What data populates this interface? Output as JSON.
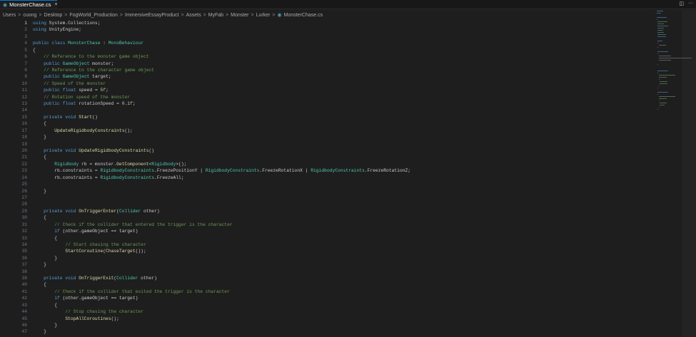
{
  "tab": {
    "icon": "csharp-file-icon",
    "label": "MonsterChase.cs",
    "close": "×"
  },
  "window_actions": [
    {
      "name": "split-editor-icon",
      "glyph": "◫"
    },
    {
      "name": "more-actions-icon",
      "glyph": "···"
    }
  ],
  "breadcrumb": {
    "segments": [
      "Users",
      "cuong",
      "Desktop",
      "FogWorld_Production",
      "ImmersiveEssayProduct",
      "Assets",
      "MyFab",
      "Monster",
      "Lurker"
    ],
    "file": "MonsterChase.cs",
    "separator": ">"
  },
  "colors": {
    "background": "#1e1e1e",
    "keyword": "#569cd6",
    "comment": "#6a9955",
    "number": "#b5cea8",
    "type": "#4ec9b0",
    "function": "#dcdcaa",
    "text": "#cccccc",
    "line_number": "#6e7681",
    "accent": "#0078d4"
  },
  "editor": {
    "active_line": 1,
    "lines": [
      {
        "n": "1",
        "text": "using System.Collections;"
      },
      {
        "n": "2",
        "text": "using UnityEngine;"
      },
      {
        "n": "3",
        "text": ""
      },
      {
        "n": "4",
        "text": "public class MonsterChase : MonoBehaviour"
      },
      {
        "n": "5",
        "text": "{"
      },
      {
        "n": "6",
        "text": "    // Reference to the monster game object"
      },
      {
        "n": "7",
        "text": "    public GameObject monster;"
      },
      {
        "n": "8",
        "text": "    // Reference to the character game object"
      },
      {
        "n": "9",
        "text": "    public GameObject target;"
      },
      {
        "n": "10",
        "text": "    // Speed of the monster"
      },
      {
        "n": "11",
        "text": "    public float speed = 5f;"
      },
      {
        "n": "12",
        "text": "    // Rotation speed of the monster"
      },
      {
        "n": "13",
        "text": "    public float rotationSpeed = 0.1f;"
      },
      {
        "n": "14",
        "text": ""
      },
      {
        "n": "15",
        "text": "    private void Start()"
      },
      {
        "n": "16",
        "text": "    {"
      },
      {
        "n": "17",
        "text": "        UpdateRigidbodyConstraints();"
      },
      {
        "n": "18",
        "text": "    }"
      },
      {
        "n": "19",
        "text": ""
      },
      {
        "n": "20",
        "text": "    private void UpdateRigidbodyConstraints()"
      },
      {
        "n": "21",
        "text": "    {"
      },
      {
        "n": "22",
        "text": "        Rigidbody rb = monster.GetComponent<Rigidbody>();"
      },
      {
        "n": "23",
        "text": "        rb.constraints = RigidbodyConstraints.FreezePositionY | RigidbodyConstraints.FreezeRotationX | RigidbodyConstraints.FreezeRotationZ;"
      },
      {
        "n": "24",
        "text": "        rb.constraints = RigidbodyConstraints.FreezeAll;"
      },
      {
        "n": "25",
        "text": ""
      },
      {
        "n": "26",
        "text": "    }"
      },
      {
        "n": "27",
        "text": ""
      },
      {
        "n": "28",
        "text": ""
      },
      {
        "n": "29",
        "text": "    private void OnTriggerEnter(Collider other)"
      },
      {
        "n": "30",
        "text": "    {"
      },
      {
        "n": "31",
        "text": "        // Check if the collider that entered the trigger is the character"
      },
      {
        "n": "32",
        "text": "        if (other.gameObject == target)"
      },
      {
        "n": "33",
        "text": "        {"
      },
      {
        "n": "34",
        "text": "            // Start chasing the character"
      },
      {
        "n": "35",
        "text": "            StartCoroutine(ChaseTarget());"
      },
      {
        "n": "36",
        "text": "        }"
      },
      {
        "n": "37",
        "text": "    }"
      },
      {
        "n": "38",
        "text": ""
      },
      {
        "n": "39",
        "text": "    private void OnTriggerExit(Collider other)"
      },
      {
        "n": "40",
        "text": "    {"
      },
      {
        "n": "41",
        "text": "        // Check if the collider that exited the trigger is the character"
      },
      {
        "n": "42",
        "text": "        if (other.gameObject == target)"
      },
      {
        "n": "43",
        "text": "        {"
      },
      {
        "n": "44",
        "text": "            // Stop chasing the character"
      },
      {
        "n": "45",
        "text": "            StopAllCoroutines();"
      },
      {
        "n": "46",
        "text": "        }"
      },
      {
        "n": "47",
        "text": "    }"
      }
    ]
  }
}
